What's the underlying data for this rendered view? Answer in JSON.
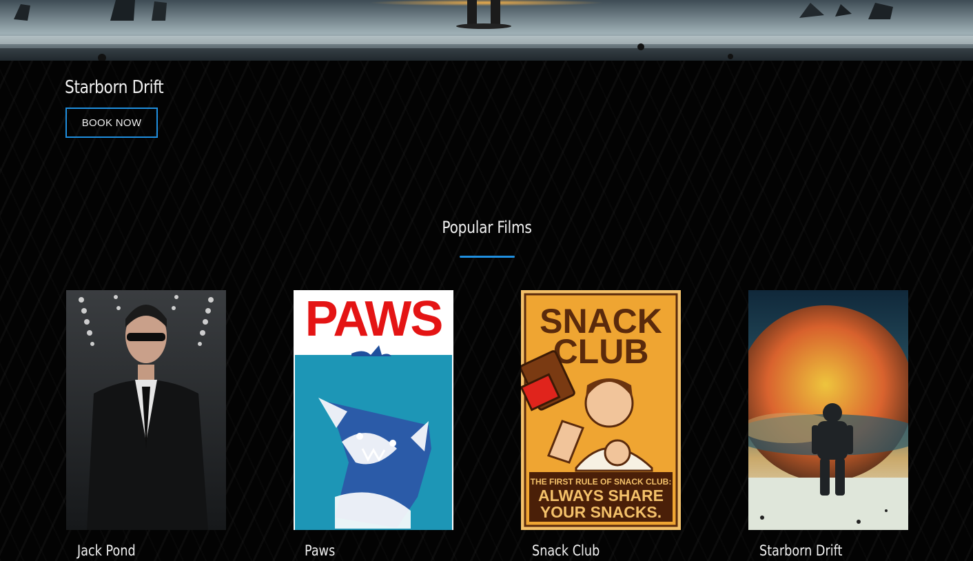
{
  "hero": {
    "title": "Starborn Drift",
    "book_label": "BOOK NOW"
  },
  "popular": {
    "heading": "Popular Films",
    "films": [
      {
        "name": "Jack Pond"
      },
      {
        "name": "Paws",
        "poster_text": "PAWS"
      },
      {
        "name": "Snack Club",
        "poster_text": [
          "SNACK",
          "CLUB",
          "THE FIRST RULE OF SNACK CLUB:",
          "ALWAYS SHARE",
          "YOUR SNACKS."
        ]
      },
      {
        "name": "Starborn Drift"
      }
    ]
  },
  "colors": {
    "accent": "#1f8fe0",
    "background": "#030303",
    "text": "#f2f2f2"
  }
}
